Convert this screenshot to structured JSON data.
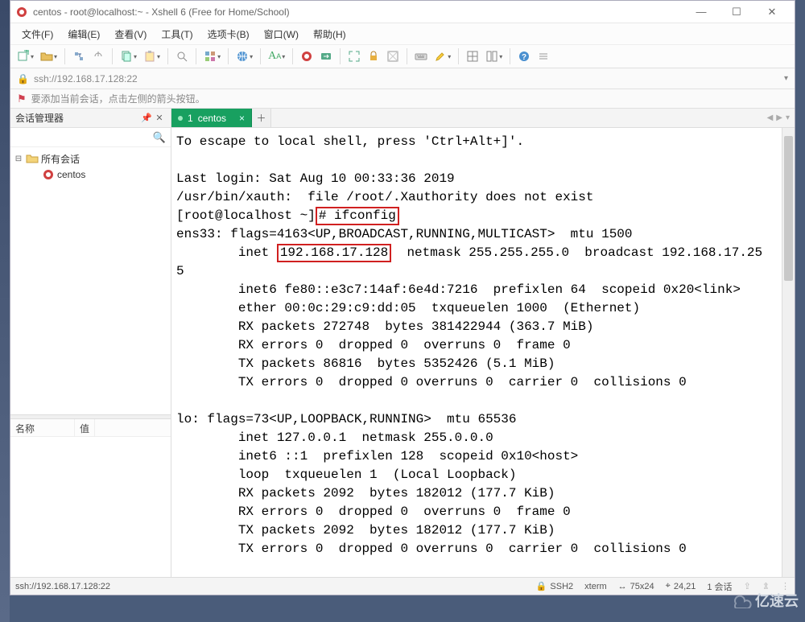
{
  "window": {
    "title": "centos - root@localhost:~ - Xshell 6 (Free for Home/School)"
  },
  "menu": {
    "file": "文件(F)",
    "edit": "编辑(E)",
    "view": "查看(V)",
    "tools": "工具(T)",
    "tabs": "选项卡(B)",
    "window": "窗口(W)",
    "help": "帮助(H)"
  },
  "address": {
    "url": "ssh://192.168.17.128:22"
  },
  "hint": {
    "text": "要添加当前会话，点击左侧的箭头按钮。"
  },
  "sidebar": {
    "title": "会话管理器",
    "search_placeholder": "",
    "root": "所有会话",
    "items": [
      "centos"
    ],
    "col_name": "名称",
    "col_value": "值"
  },
  "tabs": {
    "active": {
      "index": "1",
      "label": "centos"
    }
  },
  "tab_nav": {
    "left": "◀",
    "right": "▶",
    "menu": "▾"
  },
  "terminal": {
    "escape": "To escape to local shell, press 'Ctrl+Alt+]'.",
    "last_login": "Last login: Sat Aug 10 00:33:36 2019",
    "xauth": "/usr/bin/xauth:  file /root/.Xauthority does not exist",
    "prompt_prefix": "[root@localhost ~]",
    "cmd": "# ifconfig",
    "ens_header": "ens33: flags=4163<UP,BROADCAST,RUNNING,MULTICAST>  mtu 1500",
    "ens_inet_pre": "        inet ",
    "ens_ip": "192.168.17.128",
    "ens_inet_post": "  netmask 255.255.255.0  broadcast 192.168.17.25",
    "ens_inet_wrap": "5",
    "ens_inet6": "        inet6 fe80::e3c7:14af:6e4d:7216  prefixlen 64  scopeid 0x20<link>",
    "ens_ether": "        ether 00:0c:29:c9:dd:05  txqueuelen 1000  (Ethernet)",
    "ens_rxp": "        RX packets 272748  bytes 381422944 (363.7 MiB)",
    "ens_rxe": "        RX errors 0  dropped 0  overruns 0  frame 0",
    "ens_txp": "        TX packets 86816  bytes 5352426 (5.1 MiB)",
    "ens_txe": "        TX errors 0  dropped 0 overruns 0  carrier 0  collisions 0",
    "lo_header": "lo: flags=73<UP,LOOPBACK,RUNNING>  mtu 65536",
    "lo_inet": "        inet 127.0.0.1  netmask 255.0.0.0",
    "lo_inet6": "        inet6 ::1  prefixlen 128  scopeid 0x10<host>",
    "lo_loop": "        loop  txqueuelen 1  (Local Loopback)",
    "lo_rxp": "        RX packets 2092  bytes 182012 (177.7 KiB)",
    "lo_rxe": "        RX errors 0  dropped 0  overruns 0  frame 0",
    "lo_txp": "        TX packets 2092  bytes 182012 (177.7 KiB)",
    "lo_txe": "        TX errors 0  dropped 0 overruns 0  carrier 0  collisions 0"
  },
  "status": {
    "addr": "ssh://192.168.17.128:22",
    "proto": "SSH2",
    "term": "xterm",
    "size": "75x24",
    "cursor": "24,21",
    "sessions": "1 会话"
  },
  "watermark": "亿速云"
}
